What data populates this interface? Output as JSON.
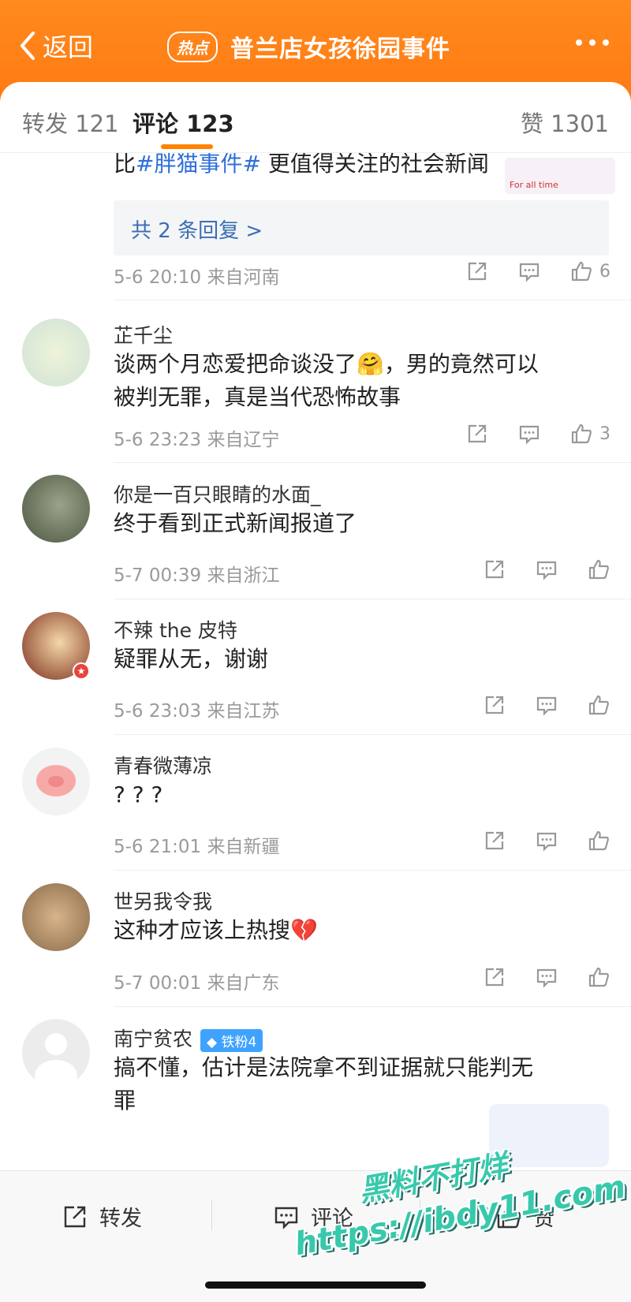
{
  "header": {
    "back_label": "返回",
    "badge": "热点",
    "title": "普兰店女孩徐园事件"
  },
  "tabs": {
    "repost": "转发 121",
    "comment": "评论 123",
    "like": "赞 1301"
  },
  "first_comment": {
    "text_prefix": "比",
    "topic": "#胖猫事件#",
    "text_suffix": " 更值得关注的社会新闻",
    "sticker_text": "For all time",
    "replies_label": "共 2 条回复 >",
    "meta": "5-6 20:10  来自河南",
    "likes": "6"
  },
  "comments": [
    {
      "name": "芷千尘",
      "text1": "谈两个月恋爱把命谈没了",
      "emoji": "🤗",
      "text2": "，男的竟然可以",
      "text3": "被判无罪，真是当代恐怖故事",
      "meta": "5-6 23:23  来自辽宁",
      "likes": "3"
    },
    {
      "name": "你是一百只眼睛的水面_",
      "text": "终于看到正式新闻报道了",
      "meta": "5-7 00:39  来自浙江"
    },
    {
      "name": "不辣 the 皮特",
      "text": "疑罪从无，谢谢",
      "meta": "5-6 23:03  来自江苏"
    },
    {
      "name": "青春微薄凉",
      "text": "? ? ?",
      "meta": "5-6 21:01  来自新疆"
    },
    {
      "name": "世另我令我",
      "text": "这种才应该上热搜",
      "emoji": "💔",
      "meta": "5-7 00:01  来自广东"
    },
    {
      "name": "南宁贫农",
      "badge": "◆ 铁粉4",
      "text1": "搞不懂，估计是法院拿不到证据就只能判无",
      "text2": "罪"
    }
  ],
  "bottom_bar": {
    "repost": "转发",
    "comment": "评论",
    "like": "赞"
  },
  "watermark": {
    "line1": "黑料不打烊",
    "line2": "https://ibdy11.com"
  },
  "colors": {
    "header_orange": "#ff7a12",
    "accent": "#ff8200",
    "topic_blue": "#2e6fd8",
    "watermark": "#38c9ac"
  }
}
